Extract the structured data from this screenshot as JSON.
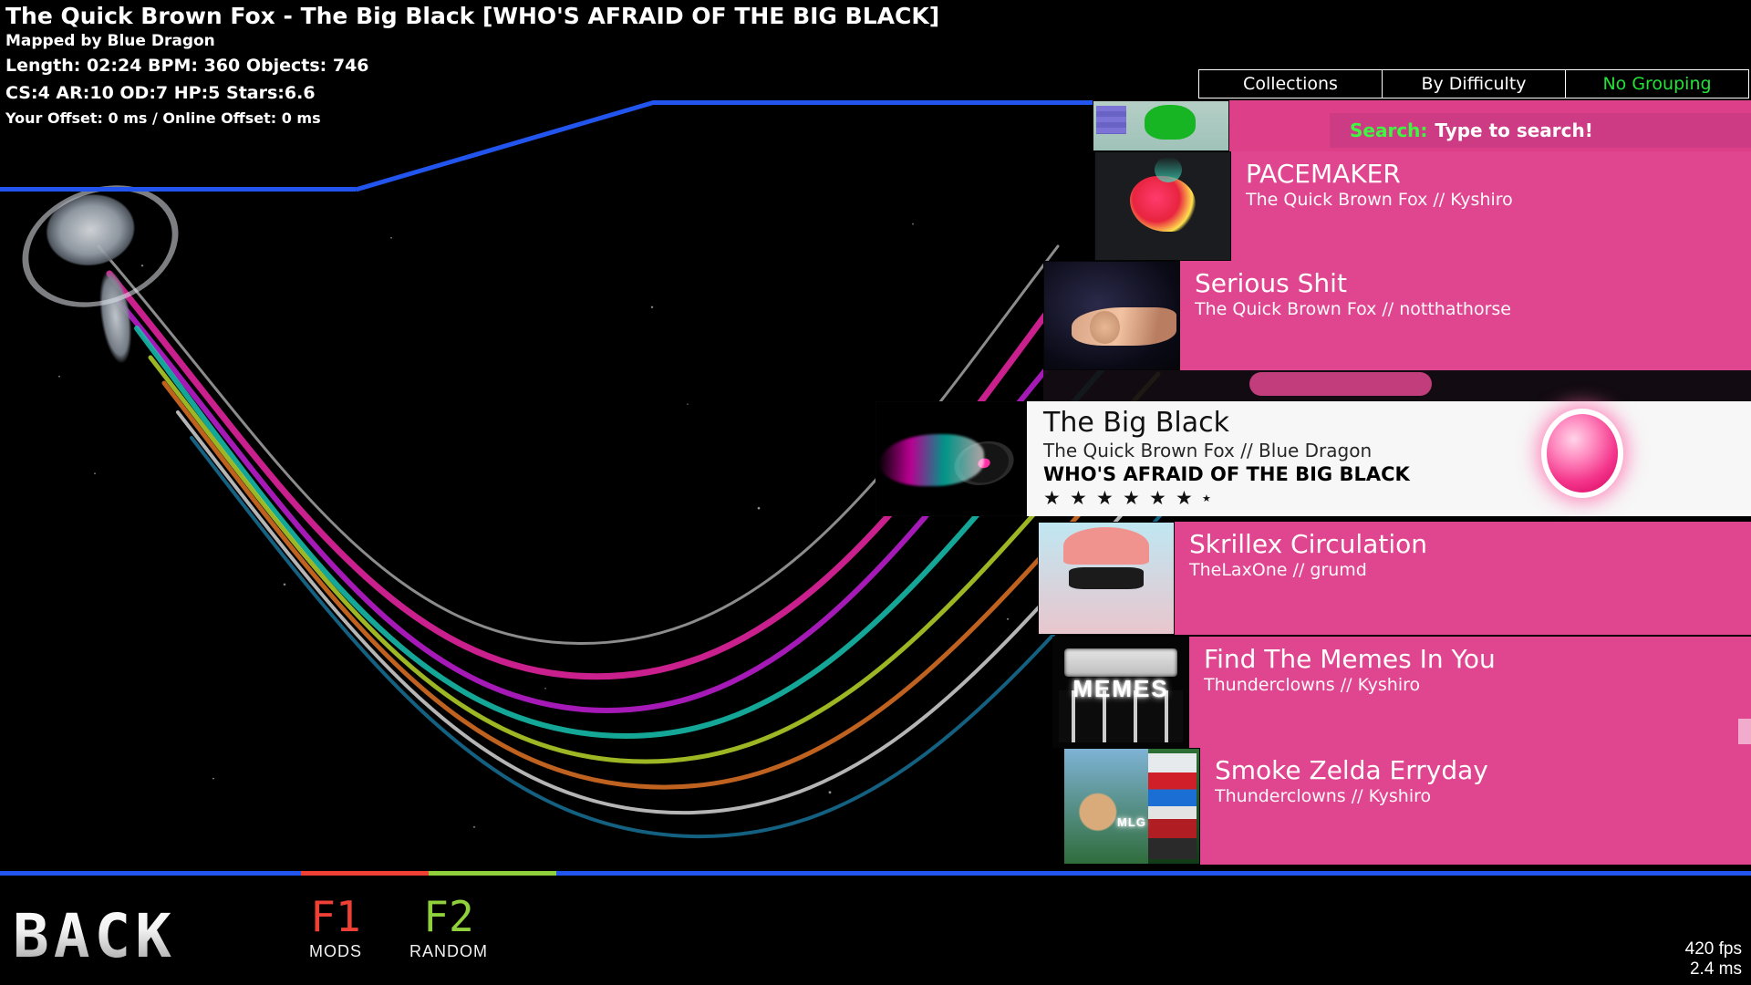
{
  "header": {
    "title": "The Quick Brown Fox - The Big Black [WHO'S AFRAID OF THE BIG BLACK]",
    "mapper": "Mapped by Blue Dragon",
    "stats": "Length: 02:24 BPM: 360 Objects: 746",
    "difficulty_stats": "CS:4 AR:10 OD:7 HP:5 Stars:6.6",
    "offset": "Your Offset: 0 ms / Online Offset: 0 ms"
  },
  "grouping_tabs": [
    {
      "label": "Collections",
      "active": false
    },
    {
      "label": "By Difficulty",
      "active": false
    },
    {
      "label": "No Grouping",
      "active": true
    }
  ],
  "search": {
    "label": "Search:",
    "value": "Type to search!"
  },
  "beatmaps": [
    {
      "title": "",
      "artist_mapper": "",
      "thumb": "yoshi-thumbnail",
      "selected": false
    },
    {
      "title": "PACEMAKER",
      "artist_mapper": "The Quick Brown Fox // Kyshiro",
      "thumb": "bug-thumbnail",
      "selected": false
    },
    {
      "title": "Serious Shit",
      "artist_mapper": "The Quick Brown Fox // notthathorse",
      "thumb": "galaxy-thumbnail",
      "selected": false
    },
    {
      "title": "The Big Black",
      "artist_mapper": "The Quick Brown Fox // Blue Dragon",
      "difficulty_name": "WHO'S AFRAID OF THE BIG BLACK",
      "stars_full": 6,
      "stars_partial": 1,
      "thumb": "vinyl-thumbnail",
      "selected": true
    },
    {
      "title": "Skrillex Circulation",
      "artist_mapper": "TheLaxOne // grumd",
      "thumb": "skrillex-thumbnail",
      "selected": false
    },
    {
      "title": "Find The Memes In You",
      "artist_mapper": "Thunderclowns // Kyshiro",
      "thumb": "memes-thumbnail",
      "thumb_text": "MEMES",
      "selected": false
    },
    {
      "title": "Smoke Zelda Erryday",
      "artist_mapper": "Thunderclowns // Kyshiro",
      "thumb": "mlg-thumbnail",
      "thumb_text": "MLG",
      "selected": false
    }
  ],
  "footer": {
    "back_label": "BACK",
    "mods_key": "F1",
    "mods_label": "MODS",
    "random_key": "F2",
    "random_label": "RANDOM",
    "fps": "420 fps",
    "frametime": "2.4 ms"
  },
  "colors": {
    "accent_pink": "#e0468f",
    "search_pink": "#cc3b84",
    "border_blue": "#2255ee",
    "active_green": "#22e336",
    "mods_red": "#ef4036",
    "random_green": "#8fd03c"
  }
}
